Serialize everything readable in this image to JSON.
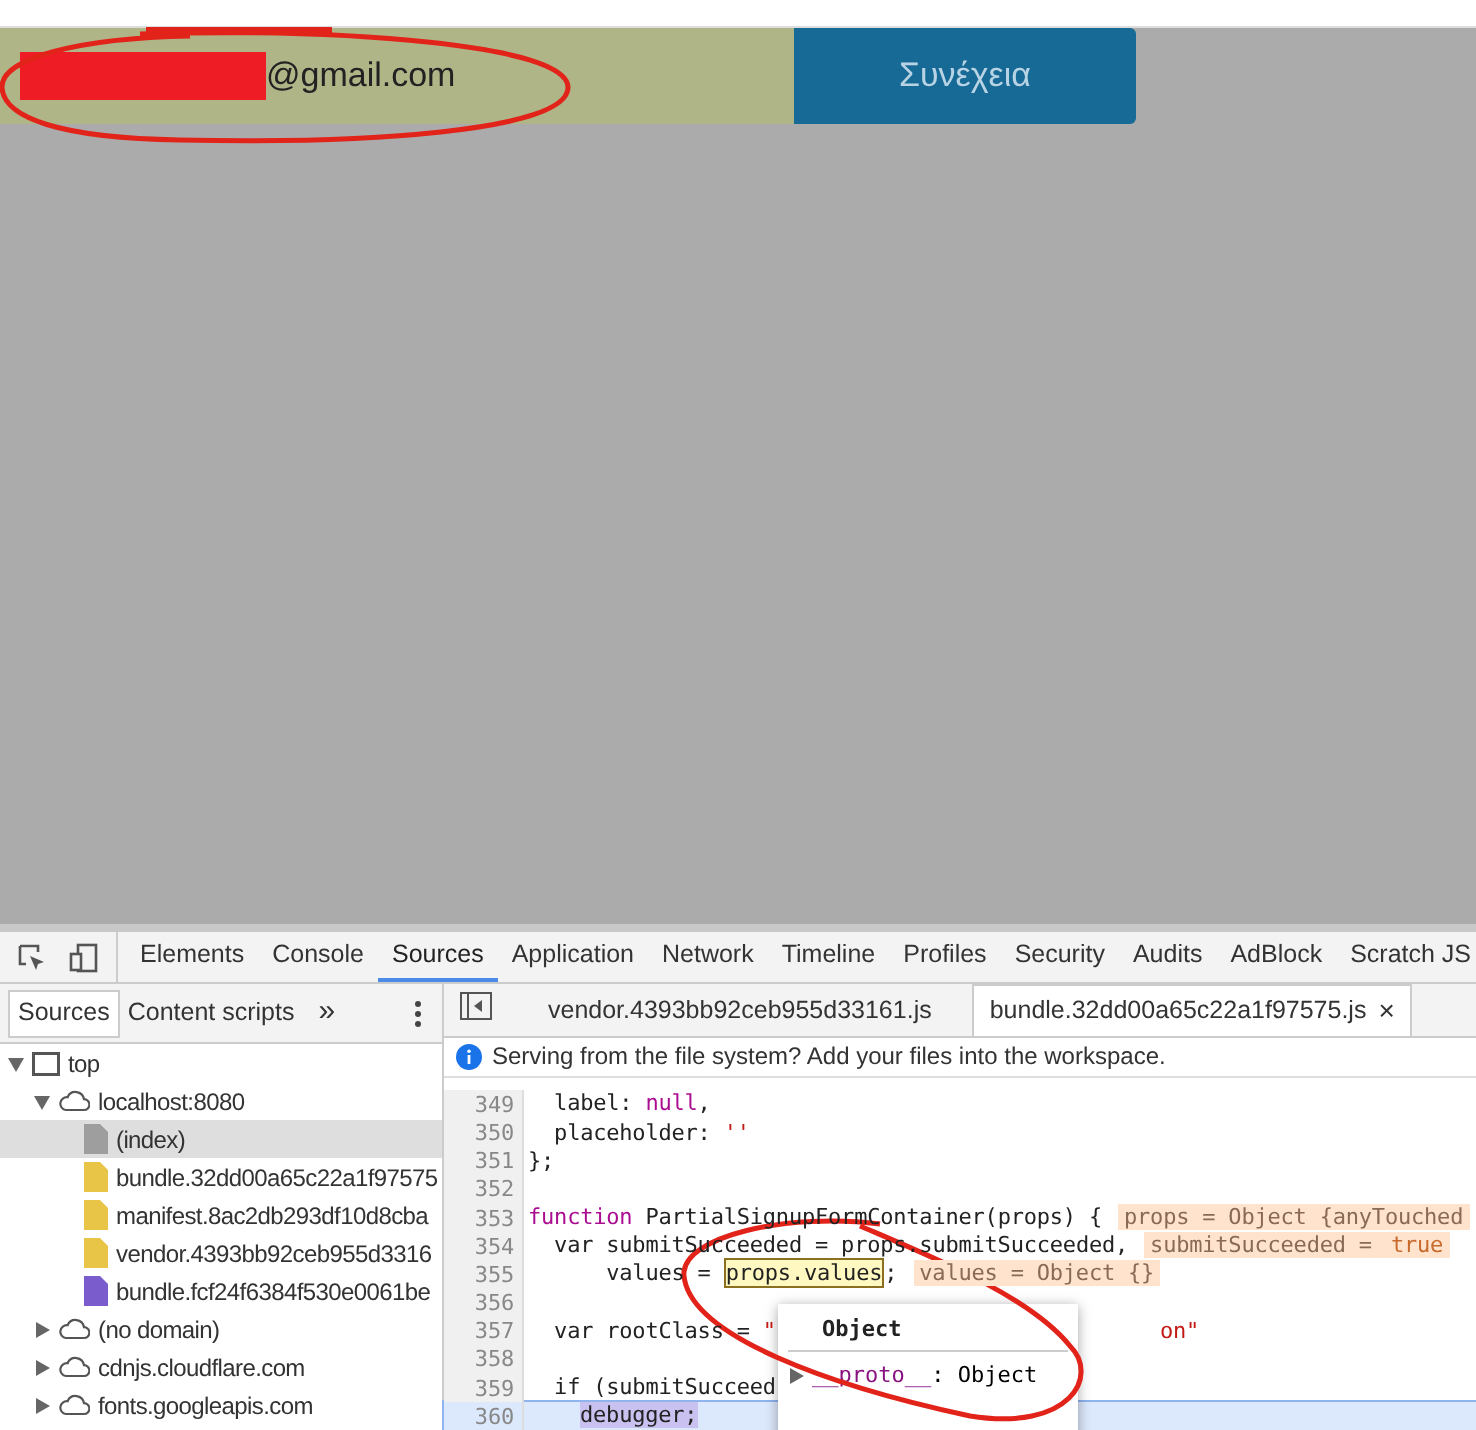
{
  "form": {
    "email_value": "@gmail.com",
    "button": "Συνέχεια"
  },
  "devtools": {
    "tabs": [
      {
        "label": "Elements",
        "selected": false
      },
      {
        "label": "Console",
        "selected": false
      },
      {
        "label": "Sources",
        "selected": true
      },
      {
        "label": "Application",
        "selected": false
      },
      {
        "label": "Network",
        "selected": false
      },
      {
        "label": "Timeline",
        "selected": false
      },
      {
        "label": "Profiles",
        "selected": false
      },
      {
        "label": "Security",
        "selected": false
      },
      {
        "label": "Audits",
        "selected": false
      },
      {
        "label": "AdBlock",
        "selected": false
      },
      {
        "label": "Scratch JS",
        "selected": false
      }
    ],
    "navigator_tabs": [
      {
        "label": "Sources",
        "selected": true
      },
      {
        "label": "Content scripts",
        "selected": false
      }
    ],
    "more": "»",
    "editor_tabs": [
      {
        "label": "vendor.4393bb92ceb955d33161.js",
        "selected": false,
        "closable": false
      },
      {
        "label": "bundle.32dd00a65c22a1f97575.js",
        "selected": true,
        "closable": true
      }
    ],
    "close_glyph": "×",
    "infobar": "Serving from the file system? Add your files into the workspace.",
    "tree": [
      {
        "kind": "frame",
        "label": "top",
        "expanded": true,
        "children": [
          {
            "kind": "domain",
            "label": "localhost:8080",
            "expanded": true,
            "children": [
              {
                "kind": "file",
                "label": "(index)",
                "color": "#9e9e9e",
                "selected": true
              },
              {
                "kind": "file",
                "label": "bundle.32dd00a65c22a1f97575",
                "color": "#e8c547",
                "selected": false
              },
              {
                "kind": "file",
                "label": "manifest.8ac2db293df10d8cba",
                "color": "#e8c547",
                "selected": false
              },
              {
                "kind": "file",
                "label": "vendor.4393bb92ceb955d3316",
                "color": "#e8c547",
                "selected": false
              },
              {
                "kind": "file",
                "label": "bundle.fcf24f6384f530e0061be",
                "color": "#7b5ccc",
                "selected": false
              }
            ]
          },
          {
            "kind": "domain",
            "label": "(no domain)",
            "expanded": false
          },
          {
            "kind": "domain",
            "label": "cdnjs.cloudflare.com",
            "expanded": false
          },
          {
            "kind": "domain",
            "label": "fonts.googleapis.com",
            "expanded": false
          }
        ]
      }
    ],
    "code": [
      {
        "number": "349",
        "current": false,
        "tokens": [
          {
            "kind": "plain",
            "text": "  label: "
          },
          {
            "kind": "literal",
            "text": "null"
          },
          {
            "kind": "plain",
            "text": ","
          }
        ]
      },
      {
        "number": "350",
        "current": false,
        "tokens": [
          {
            "kind": "plain",
            "text": "  placeholder: "
          },
          {
            "kind": "string",
            "text": "''"
          }
        ]
      },
      {
        "number": "351",
        "current": false,
        "tokens": [
          {
            "kind": "plain",
            "text": "};"
          }
        ]
      },
      {
        "number": "352",
        "current": false
      },
      {
        "number": "353",
        "current": false,
        "tokens": [
          {
            "kind": "keyword",
            "text": "function"
          },
          {
            "kind": "plain",
            "text": " PartialSignupFormContainer(props) {"
          },
          {
            "kind": "inline_value",
            "text": "props = Object {anyTouched"
          }
        ]
      },
      {
        "number": "354",
        "current": false,
        "tokens": [
          {
            "kind": "plain",
            "text": "  var submitSucceeded = props.submitSucceeded,"
          },
          {
            "kind": "inline_value",
            "text": "submitSucceeded = "
          },
          {
            "kind": "inline_literal",
            "text": "true"
          }
        ]
      },
      {
        "number": "355",
        "current": false,
        "tokens": [
          {
            "kind": "plain",
            "text": "      values = "
          },
          {
            "kind": "hover",
            "text": "props.values"
          },
          {
            "kind": "plain",
            "text": ";"
          },
          {
            "kind": "inline_value",
            "text": "values = Object {}"
          }
        ]
      },
      {
        "number": "356",
        "current": false
      },
      {
        "number": "357",
        "current": false,
        "tokens": [
          {
            "kind": "plain",
            "text": "  var rootClass = "
          },
          {
            "kind": "string",
            "text": "\""
          },
          {
            "kind": "tail",
            "text": "on\""
          }
        ]
      },
      {
        "number": "358",
        "current": false
      },
      {
        "number": "359",
        "current": false,
        "tokens": [
          {
            "kind": "plain",
            "text": "  if (submitSucceed"
          }
        ]
      },
      {
        "number": "360",
        "current": true,
        "tokens": [
          {
            "kind": "debugger",
            "text": "debugger;"
          }
        ]
      }
    ],
    "popup": {
      "title": "Object",
      "property": "__proto__",
      "separator": ": ",
      "value": "Object"
    }
  }
}
